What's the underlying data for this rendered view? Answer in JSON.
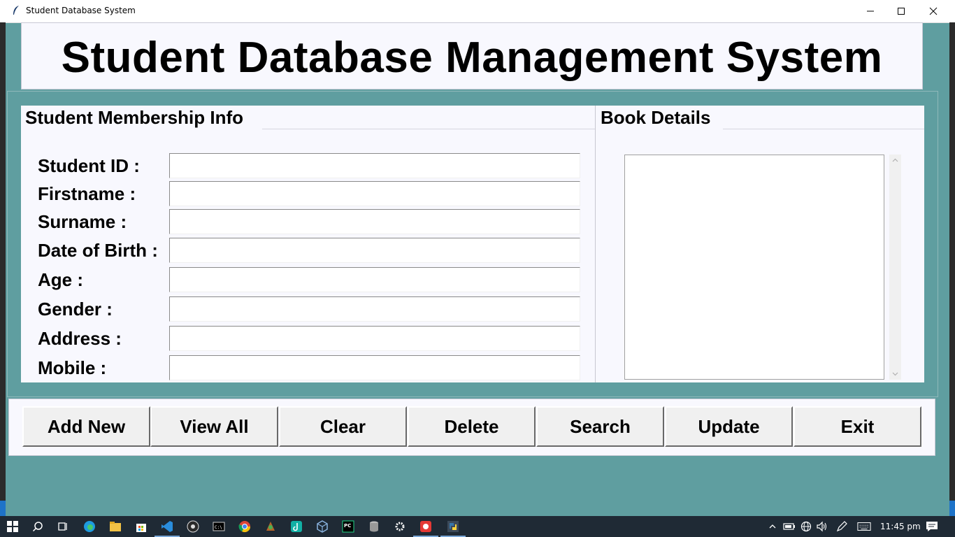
{
  "window": {
    "title": "Student Database System"
  },
  "header": {
    "title": "Student Database Management System"
  },
  "membership_panel": {
    "label": "Student Membership Info",
    "fields": [
      {
        "label": "Student ID :",
        "value": ""
      },
      {
        "label": "Firstname :",
        "value": ""
      },
      {
        "label": "Surname :",
        "value": ""
      },
      {
        "label": "Date of Birth :",
        "value": ""
      },
      {
        "label": "Age :",
        "value": ""
      },
      {
        "label": "Gender :",
        "value": ""
      },
      {
        "label": "Address :",
        "value": ""
      },
      {
        "label": "Mobile :",
        "value": ""
      }
    ]
  },
  "book_panel": {
    "label": "Book Details",
    "items": []
  },
  "buttons": {
    "add_new": "Add New",
    "view_all": "View All",
    "clear": "Clear",
    "delete": "Delete",
    "search": "Search",
    "update": "Update",
    "exit": "Exit"
  },
  "taskbar": {
    "clock": "11:45 pm",
    "apps": [
      "start-icon",
      "search-icon",
      "task-view-icon",
      "edge-icon",
      "file-explorer-icon",
      "store-icon",
      "vscode-icon",
      "obs-icon",
      "terminal-icon",
      "chrome-icon",
      "game-icon",
      "tiktok-icon",
      "virtualbox-icon",
      "pycharm-icon",
      "database-icon",
      "settings-icon",
      "recorder-icon",
      "python-icon"
    ]
  },
  "colors": {
    "window_bg": "#5f9ea0",
    "panel_bg": "#f8f8fe",
    "button_bg": "#f0f0f0",
    "taskbar_bg": "#1f2a35"
  }
}
